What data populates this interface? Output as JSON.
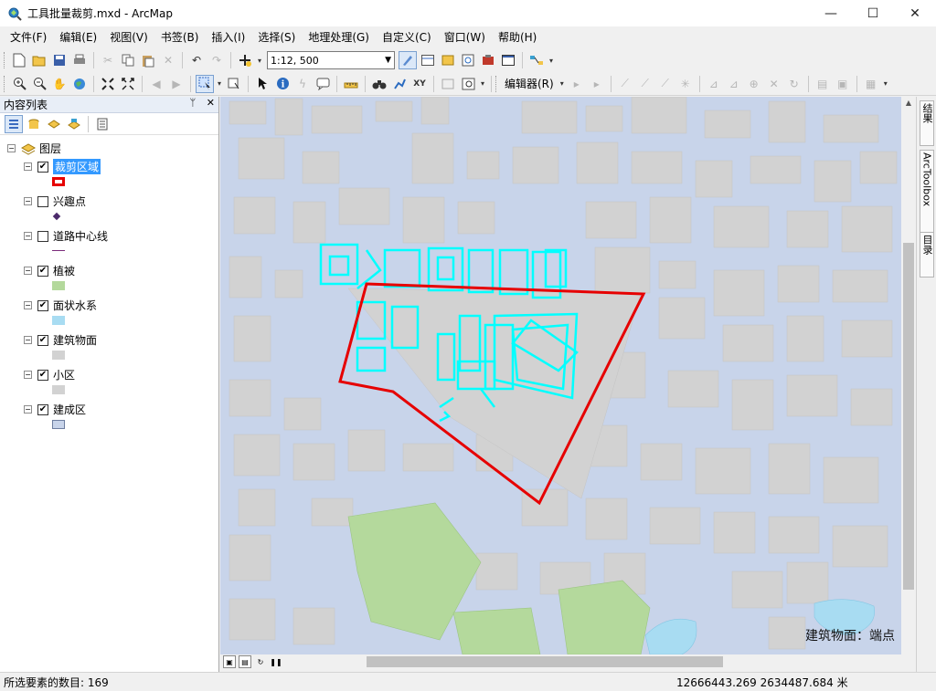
{
  "window": {
    "title": "工具批量裁剪.mxd - ArcMap",
    "minimize": "—",
    "maximize": "☐",
    "close": "✕"
  },
  "menubar": {
    "items": [
      "文件(F)",
      "编辑(E)",
      "视图(V)",
      "书签(B)",
      "插入(I)",
      "选择(S)",
      "地理处理(G)",
      "自定义(C)",
      "窗口(W)",
      "帮助(H)"
    ]
  },
  "toolbar": {
    "scale_value": "1:12, 500",
    "editor_label": "编辑器(R)"
  },
  "toc": {
    "title": "内容列表",
    "pin": "ᛘ",
    "close": "✕",
    "root_label": "图层",
    "layers": [
      {
        "label": "裁剪区域",
        "checked": true,
        "selected": true,
        "symbol": "polygon-outline",
        "color": "#e60000"
      },
      {
        "label": "兴趣点",
        "checked": false,
        "selected": false,
        "symbol": "point",
        "color": "#4b2a6b"
      },
      {
        "label": "道路中心线",
        "checked": false,
        "selected": false,
        "symbol": "line",
        "color": "#7a2b7a"
      },
      {
        "label": "植被",
        "checked": true,
        "selected": false,
        "symbol": "fill",
        "color": "#b4d99c"
      },
      {
        "label": "面状水系",
        "checked": true,
        "selected": false,
        "symbol": "fill",
        "color": "#a8dcf2"
      },
      {
        "label": "建筑物面",
        "checked": true,
        "selected": false,
        "symbol": "fill",
        "color": "#d2d2d2"
      },
      {
        "label": "小区",
        "checked": true,
        "selected": false,
        "symbol": "fill",
        "color": "#d2d2d2"
      },
      {
        "label": "建成区",
        "checked": true,
        "selected": false,
        "symbol": "fill-outline",
        "color": "#c8d4ea"
      }
    ]
  },
  "map": {
    "label_text": "建筑物面：端点",
    "colors": {
      "background": "#c8d4ea",
      "building": "#d2d2d2",
      "vegetation": "#b4d99c",
      "water": "#a8dcf2",
      "selection": "#00ffff",
      "clip_boundary": "#e60000"
    }
  },
  "dock": {
    "tabs": [
      "结果",
      "ArcToolbox",
      "目录"
    ]
  },
  "status": {
    "selected_count": "所选要素的数目: 169",
    "coordinates": "12666443.269  2634487.684 米"
  }
}
